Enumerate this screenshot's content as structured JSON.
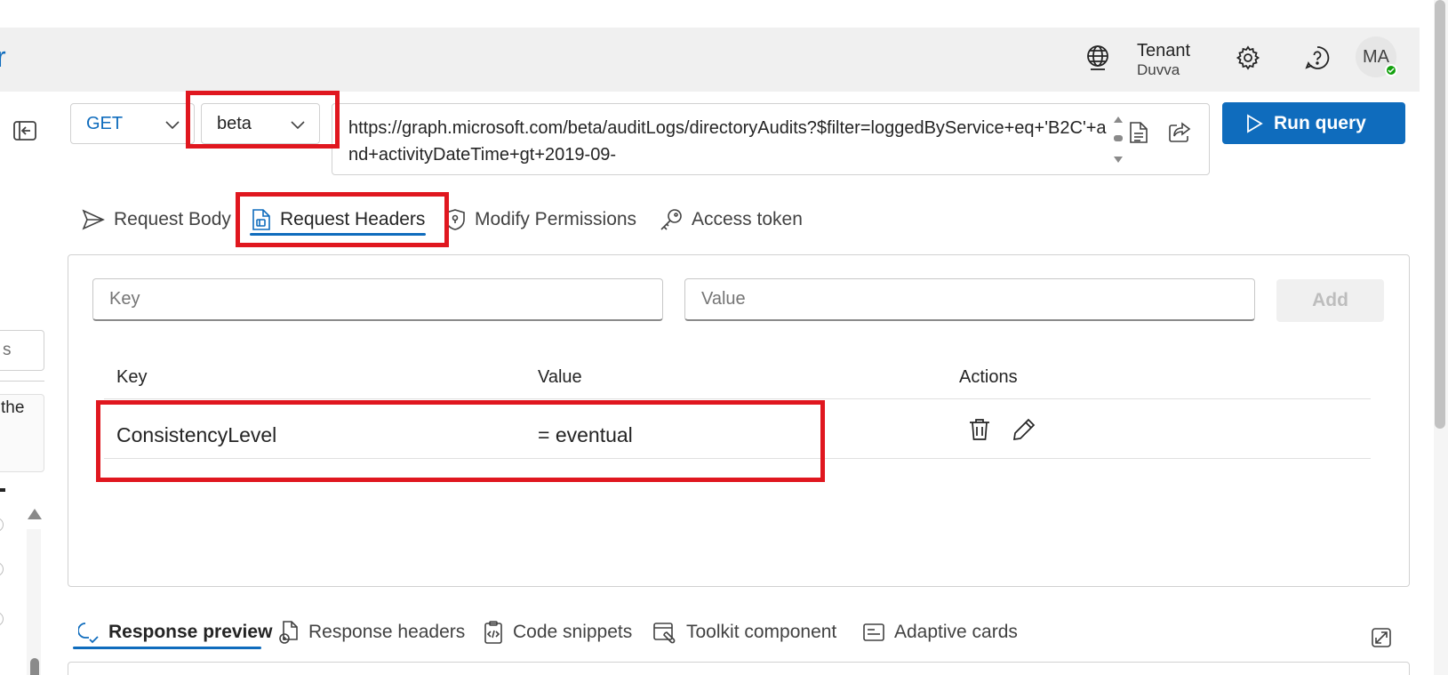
{
  "header": {
    "brand_fragment": "r",
    "tenant_label": "Tenant",
    "tenant_name": "Duvva",
    "avatar_initials": "MA"
  },
  "sidebar": {
    "search_fragment": "s",
    "card_fragment": "the"
  },
  "query": {
    "method": "GET",
    "version": "beta",
    "url": "https://graph.microsoft.com/beta/auditLogs/directoryAudits?$filter=loggedByService+eq+'B2C'+and+activityDateTime+gt+2019-09-",
    "run_label": "Run query"
  },
  "request_tabs": [
    {
      "label": "Request Body",
      "icon": "send-icon"
    },
    {
      "label": "Request Headers",
      "icon": "document-header-icon",
      "active": true
    },
    {
      "label": "Modify Permissions",
      "icon": "shield-lock-icon"
    },
    {
      "label": "Access token",
      "icon": "key-icon"
    }
  ],
  "headers_form": {
    "key_placeholder": "Key",
    "value_placeholder": "Value",
    "add_label": "Add"
  },
  "headers_table": {
    "columns": [
      "Key",
      "Value",
      "Actions"
    ],
    "rows": [
      {
        "key": "ConsistencyLevel",
        "value": "= eventual"
      }
    ]
  },
  "response_tabs": [
    {
      "label": "Response preview",
      "icon": "preview-icon",
      "active": true
    },
    {
      "label": "Response headers",
      "icon": "document-headers-icon"
    },
    {
      "label": "Code snippets",
      "icon": "code-snippet-icon"
    },
    {
      "label": "Toolkit component",
      "icon": "toolkit-icon"
    },
    {
      "label": "Adaptive cards",
      "icon": "card-icon"
    }
  ],
  "colors": {
    "accent": "#0f6cbd",
    "highlight": "#e0171f",
    "presence": "#13a10e"
  }
}
